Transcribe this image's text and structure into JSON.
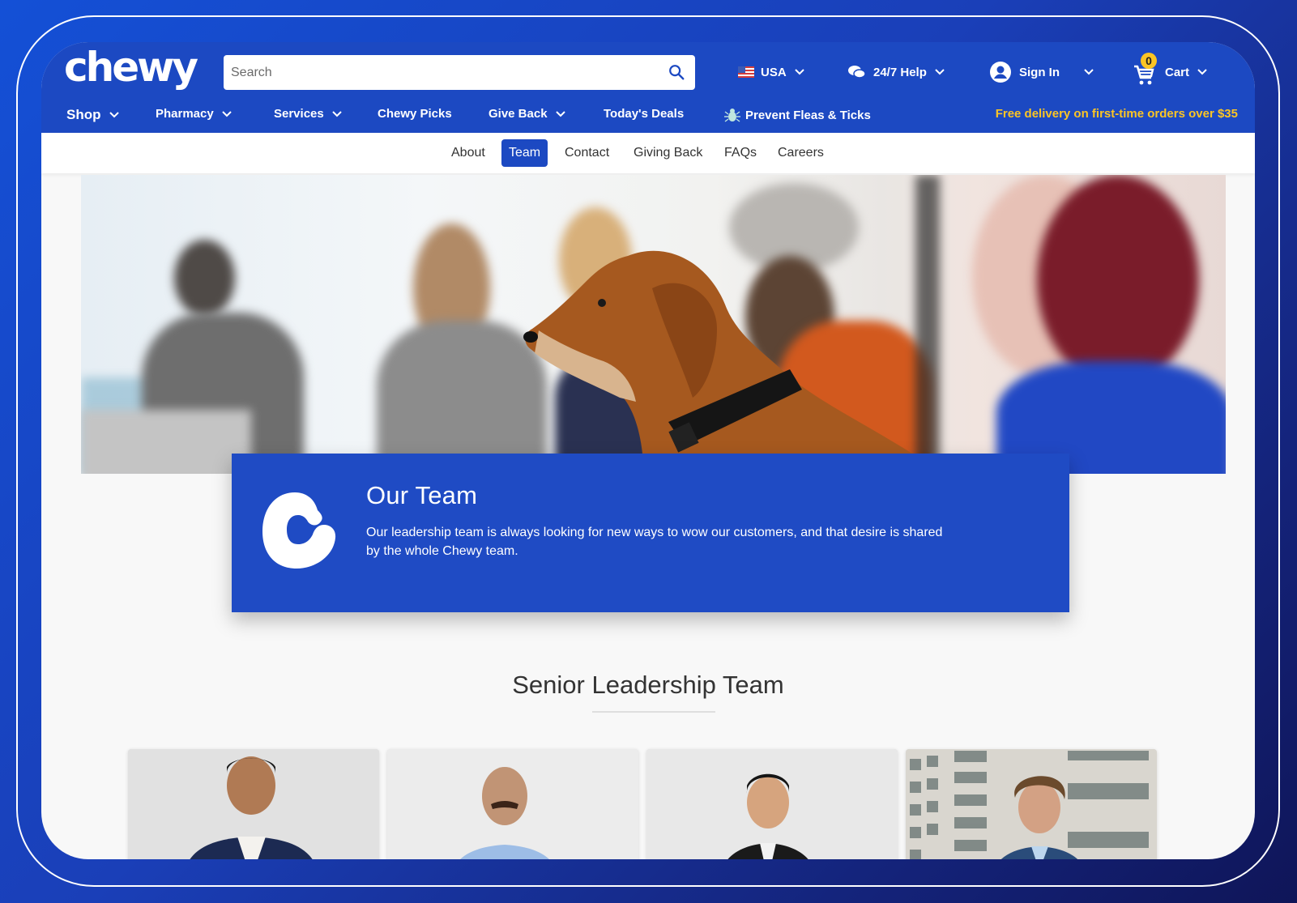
{
  "header": {
    "logo": "chewy",
    "search": {
      "placeholder": "Search",
      "value": ""
    },
    "utilities": {
      "country": "USA",
      "help": "24/7 Help",
      "sign_in": "Sign In",
      "cart": "Cart",
      "cart_count": "0"
    },
    "nav": [
      {
        "label": "Shop",
        "has_dropdown": true
      },
      {
        "label": "Pharmacy",
        "has_dropdown": true
      },
      {
        "label": "Services",
        "has_dropdown": true
      },
      {
        "label": "Chewy Picks",
        "has_dropdown": false
      },
      {
        "label": "Give Back",
        "has_dropdown": true
      },
      {
        "label": "Today's Deals",
        "has_dropdown": false
      },
      {
        "label": "Prevent Fleas & Ticks",
        "has_dropdown": false,
        "icon": "flea-tick-icon"
      }
    ],
    "promo": "Free delivery on first-time orders over $35"
  },
  "subnav": {
    "items": [
      "About",
      "Team",
      "Contact",
      "Giving Back",
      "FAQs",
      "Careers"
    ],
    "active": "Team"
  },
  "hero": {
    "image_description": "Chewy employees in a meeting with a brown dog wearing a black collar"
  },
  "panel": {
    "title": "Our Team",
    "text": "Our leadership team is always looking for new ways to wow our customers, and that desire is shared by the whole Chewy team."
  },
  "leadership": {
    "title": "Senior Leadership Team",
    "cards": [
      {
        "photo": "Leader portrait: smiling man with glasses, navy blazer, white shirt"
      },
      {
        "photo": "Leader portrait: bald man with mustache, light blue shirt"
      },
      {
        "photo": "Leader portrait: smiling man with glasses, black suit"
      },
      {
        "photo": "Leader portrait: curly-haired man, blue blazer, office buildings behind"
      }
    ]
  },
  "colors": {
    "brand_blue": "#1c49c2",
    "panel_blue": "#1f4bc4",
    "promo_yellow": "#fbc524",
    "cart_badge": "#fbc524"
  }
}
